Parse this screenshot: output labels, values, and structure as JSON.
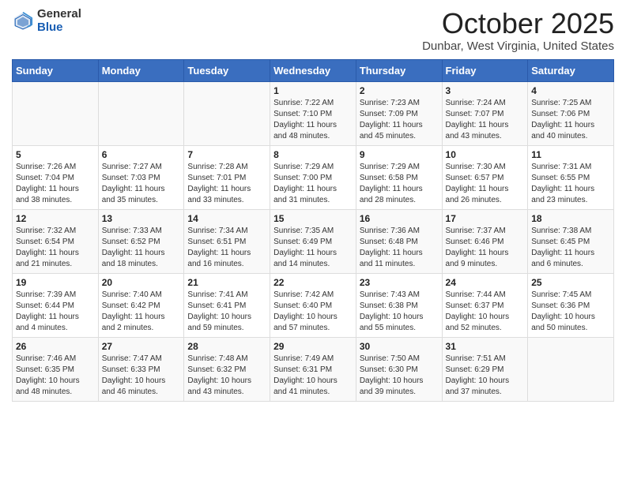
{
  "header": {
    "logo_general": "General",
    "logo_blue": "Blue",
    "month": "October 2025",
    "location": "Dunbar, West Virginia, United States"
  },
  "days_of_week": [
    "Sunday",
    "Monday",
    "Tuesday",
    "Wednesday",
    "Thursday",
    "Friday",
    "Saturday"
  ],
  "weeks": [
    [
      {
        "day": "",
        "content": ""
      },
      {
        "day": "",
        "content": ""
      },
      {
        "day": "",
        "content": ""
      },
      {
        "day": "1",
        "content": "Sunrise: 7:22 AM\nSunset: 7:10 PM\nDaylight: 11 hours\nand 48 minutes."
      },
      {
        "day": "2",
        "content": "Sunrise: 7:23 AM\nSunset: 7:09 PM\nDaylight: 11 hours\nand 45 minutes."
      },
      {
        "day": "3",
        "content": "Sunrise: 7:24 AM\nSunset: 7:07 PM\nDaylight: 11 hours\nand 43 minutes."
      },
      {
        "day": "4",
        "content": "Sunrise: 7:25 AM\nSunset: 7:06 PM\nDaylight: 11 hours\nand 40 minutes."
      }
    ],
    [
      {
        "day": "5",
        "content": "Sunrise: 7:26 AM\nSunset: 7:04 PM\nDaylight: 11 hours\nand 38 minutes."
      },
      {
        "day": "6",
        "content": "Sunrise: 7:27 AM\nSunset: 7:03 PM\nDaylight: 11 hours\nand 35 minutes."
      },
      {
        "day": "7",
        "content": "Sunrise: 7:28 AM\nSunset: 7:01 PM\nDaylight: 11 hours\nand 33 minutes."
      },
      {
        "day": "8",
        "content": "Sunrise: 7:29 AM\nSunset: 7:00 PM\nDaylight: 11 hours\nand 31 minutes."
      },
      {
        "day": "9",
        "content": "Sunrise: 7:29 AM\nSunset: 6:58 PM\nDaylight: 11 hours\nand 28 minutes."
      },
      {
        "day": "10",
        "content": "Sunrise: 7:30 AM\nSunset: 6:57 PM\nDaylight: 11 hours\nand 26 minutes."
      },
      {
        "day": "11",
        "content": "Sunrise: 7:31 AM\nSunset: 6:55 PM\nDaylight: 11 hours\nand 23 minutes."
      }
    ],
    [
      {
        "day": "12",
        "content": "Sunrise: 7:32 AM\nSunset: 6:54 PM\nDaylight: 11 hours\nand 21 minutes."
      },
      {
        "day": "13",
        "content": "Sunrise: 7:33 AM\nSunset: 6:52 PM\nDaylight: 11 hours\nand 18 minutes."
      },
      {
        "day": "14",
        "content": "Sunrise: 7:34 AM\nSunset: 6:51 PM\nDaylight: 11 hours\nand 16 minutes."
      },
      {
        "day": "15",
        "content": "Sunrise: 7:35 AM\nSunset: 6:49 PM\nDaylight: 11 hours\nand 14 minutes."
      },
      {
        "day": "16",
        "content": "Sunrise: 7:36 AM\nSunset: 6:48 PM\nDaylight: 11 hours\nand 11 minutes."
      },
      {
        "day": "17",
        "content": "Sunrise: 7:37 AM\nSunset: 6:46 PM\nDaylight: 11 hours\nand 9 minutes."
      },
      {
        "day": "18",
        "content": "Sunrise: 7:38 AM\nSunset: 6:45 PM\nDaylight: 11 hours\nand 6 minutes."
      }
    ],
    [
      {
        "day": "19",
        "content": "Sunrise: 7:39 AM\nSunset: 6:44 PM\nDaylight: 11 hours\nand 4 minutes."
      },
      {
        "day": "20",
        "content": "Sunrise: 7:40 AM\nSunset: 6:42 PM\nDaylight: 11 hours\nand 2 minutes."
      },
      {
        "day": "21",
        "content": "Sunrise: 7:41 AM\nSunset: 6:41 PM\nDaylight: 10 hours\nand 59 minutes."
      },
      {
        "day": "22",
        "content": "Sunrise: 7:42 AM\nSunset: 6:40 PM\nDaylight: 10 hours\nand 57 minutes."
      },
      {
        "day": "23",
        "content": "Sunrise: 7:43 AM\nSunset: 6:38 PM\nDaylight: 10 hours\nand 55 minutes."
      },
      {
        "day": "24",
        "content": "Sunrise: 7:44 AM\nSunset: 6:37 PM\nDaylight: 10 hours\nand 52 minutes."
      },
      {
        "day": "25",
        "content": "Sunrise: 7:45 AM\nSunset: 6:36 PM\nDaylight: 10 hours\nand 50 minutes."
      }
    ],
    [
      {
        "day": "26",
        "content": "Sunrise: 7:46 AM\nSunset: 6:35 PM\nDaylight: 10 hours\nand 48 minutes."
      },
      {
        "day": "27",
        "content": "Sunrise: 7:47 AM\nSunset: 6:33 PM\nDaylight: 10 hours\nand 46 minutes."
      },
      {
        "day": "28",
        "content": "Sunrise: 7:48 AM\nSunset: 6:32 PM\nDaylight: 10 hours\nand 43 minutes."
      },
      {
        "day": "29",
        "content": "Sunrise: 7:49 AM\nSunset: 6:31 PM\nDaylight: 10 hours\nand 41 minutes."
      },
      {
        "day": "30",
        "content": "Sunrise: 7:50 AM\nSunset: 6:30 PM\nDaylight: 10 hours\nand 39 minutes."
      },
      {
        "day": "31",
        "content": "Sunrise: 7:51 AM\nSunset: 6:29 PM\nDaylight: 10 hours\nand 37 minutes."
      },
      {
        "day": "",
        "content": ""
      }
    ]
  ]
}
